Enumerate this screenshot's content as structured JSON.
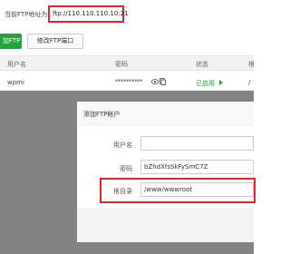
{
  "address": {
    "label": "当前FTP地址为：",
    "value": "ftp://110.110.110.10:21"
  },
  "toolbar": {
    "add_label": "加FTP",
    "change_port_label": "修改FTP端口"
  },
  "table": {
    "headers": [
      "用户名",
      "密码",
      "状态",
      "根"
    ],
    "rows": [
      {
        "username": "wpmi",
        "password": "**********",
        "status": "已启用",
        "path": "/"
      }
    ]
  },
  "modal": {
    "title": "添加FTP帐户",
    "fields": {
      "username_label": "用户名",
      "username_value": "",
      "password_label": "密码",
      "password_value": "bZhdXfsSkFySmC7Z",
      "path_label": "根目录",
      "path_value": "/www/wwwroot"
    }
  },
  "colors": {
    "accent_green": "#20a53a",
    "highlight_red": "#e0262a",
    "backdrop": "#838383"
  },
  "icons": [
    "eye-icon",
    "copy-icon",
    "play-icon"
  ]
}
